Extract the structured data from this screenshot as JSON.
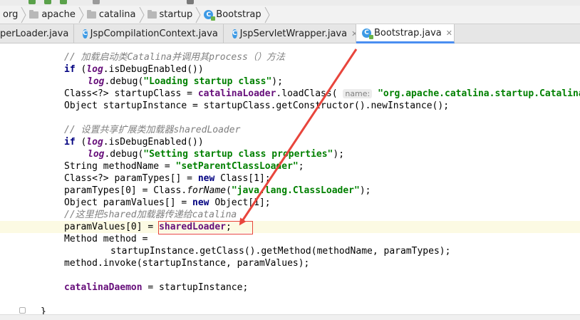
{
  "breadcrumb": [
    "org",
    "apache",
    "catalina",
    "startup",
    "Bootstrap"
  ],
  "tabs": [
    {
      "label": "perLoader.java",
      "active": false
    },
    {
      "label": "JspCompilationContext.java",
      "active": false
    },
    {
      "label": "JspServletWrapper.java",
      "active": false
    },
    {
      "label": "Bootstrap.java",
      "active": true
    }
  ],
  "code": {
    "l1": "// 加载启动类Catalina并调用其process（）方法",
    "l2a": "if",
    "l2b": " (",
    "l2c": "log",
    "l2d": ".isDebugEnabled())",
    "l3a": "log",
    "l3b": ".debug(",
    "l3c": "\"Loading startup class\"",
    "l3d": ");",
    "l4a": "Class<?> startupClass = ",
    "l4b": "catalinaLoader",
    "l4c": ".loadClass(",
    "l4d": "name:",
    "l4e": "\"org.apache.catalina.startup.Catalina\"",
    "l5": "Object startupInstance = startupClass.getConstructor().newInstance();",
    "l7": "// 设置共享扩展类加载器sharedLoader",
    "l8a": "if",
    "l8b": " (",
    "l8c": "log",
    "l8d": ".isDebugEnabled())",
    "l9a": "log",
    "l9b": ".debug(",
    "l9c": "\"Setting startup class properties\"",
    "l9d": ");",
    "l10a": "String methodName = ",
    "l10b": "\"setParentClassLoader\"",
    "l10c": ";",
    "l11a": "Class<?> paramTypes[] = ",
    "l11b": "new",
    "l11c": " Class[1];",
    "l12a": "paramTypes[0] = Class.",
    "l12b": "forName",
    "l12c": "(",
    "l12d": "\"java.lang.ClassLoader\"",
    "l12e": ");",
    "l13a": "Object paramValues[] = ",
    "l13b": "new",
    "l13c": " Object[1];",
    "l14": "//这里把shared加载器传递给catalina",
    "l15a": "paramValues[0] = ",
    "l15b": "sharedLoader",
    "l15c": ";",
    "l16": "Method method =",
    "l17": "startupInstance.getClass().getMethod(methodName, paramTypes);",
    "l18": "method.invoke(startupInstance, paramValues);",
    "l20a": "catalinaDaemon",
    "l20b": " = startupInstance;",
    "l22": "}"
  },
  "annotation": {
    "color": "#e8453c",
    "target": "sharedLoader"
  }
}
